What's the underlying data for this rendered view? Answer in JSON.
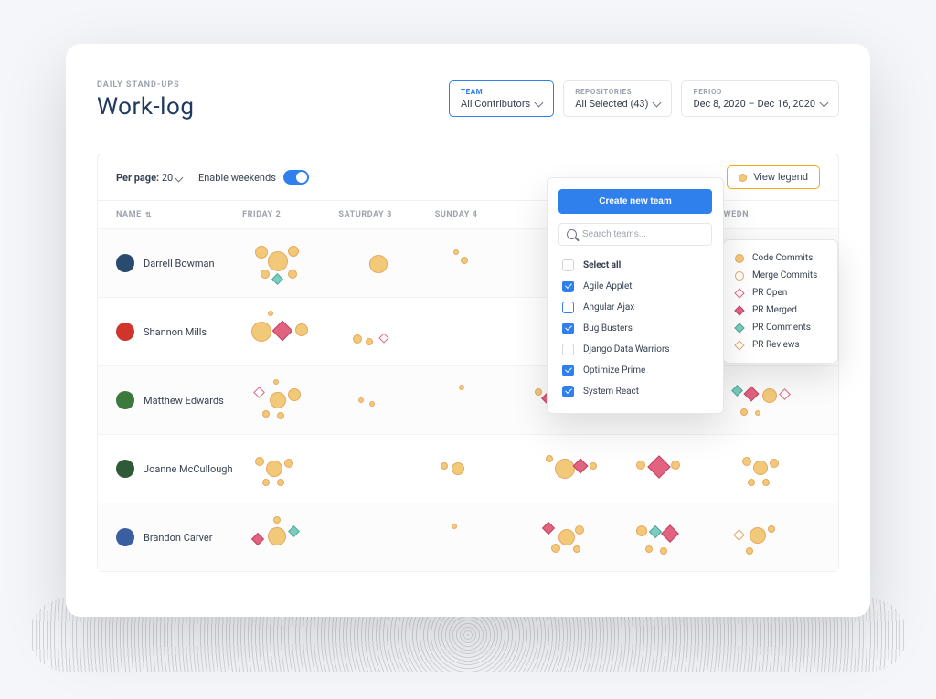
{
  "header": {
    "eyebrow": "DAILY STAND-UPS",
    "title": "Work-log"
  },
  "filters": {
    "team": {
      "label": "TEAM",
      "value": "All Contributors"
    },
    "repos": {
      "label": "REPOSITORIES",
      "value": "All Selected (43)"
    },
    "period": {
      "label": "PERIOD",
      "value": "Dec 8, 2020 – Dec 16, 2020"
    }
  },
  "toolbar": {
    "per_page_label": "Per page:",
    "per_page_value": "20",
    "weekends_label": "Enable weekends",
    "legend_button": "View legend"
  },
  "columns": {
    "name": "NAME",
    "days": [
      "FRIDAY 2",
      "SATURDAY 3",
      "SUNDAY 4",
      "",
      "",
      "WEDN"
    ]
  },
  "rows": [
    {
      "name": "Darrell Bowman",
      "avatar_bg": "#2b4a6f"
    },
    {
      "name": "Shannon Mills",
      "avatar_bg": "#d0342c"
    },
    {
      "name": "Matthew Edwards",
      "avatar_bg": "#3b7a3c"
    },
    {
      "name": "Joanne McCullough",
      "avatar_bg": "#2f5a38"
    },
    {
      "name": "Brandon Carver",
      "avatar_bg": "#3b5ea1"
    }
  ],
  "team_dropdown": {
    "create_button": "Create new team",
    "search_placeholder": "Search teams...",
    "select_all": "Select all",
    "items": [
      {
        "label": "Agile Applet",
        "checked": true
      },
      {
        "label": "Angular Ajax",
        "checked": false,
        "outlined": true
      },
      {
        "label": "Bug Busters",
        "checked": true
      },
      {
        "label": "Django Data Warriors",
        "checked": false
      },
      {
        "label": "Optimize Prime",
        "checked": true
      },
      {
        "label": "System React",
        "checked": true
      }
    ]
  },
  "legend": [
    {
      "shape": "circle",
      "label": "Code Commits"
    },
    {
      "shape": "circle-open",
      "label": "Merge Commits"
    },
    {
      "shape": "diamond-open-pink",
      "label": "PR Open"
    },
    {
      "shape": "diamond-pink",
      "label": "PR Merged"
    },
    {
      "shape": "diamond-teal",
      "label": "PR Comments"
    },
    {
      "shape": "diamond-open-orange",
      "label": "PR Reviews"
    }
  ]
}
